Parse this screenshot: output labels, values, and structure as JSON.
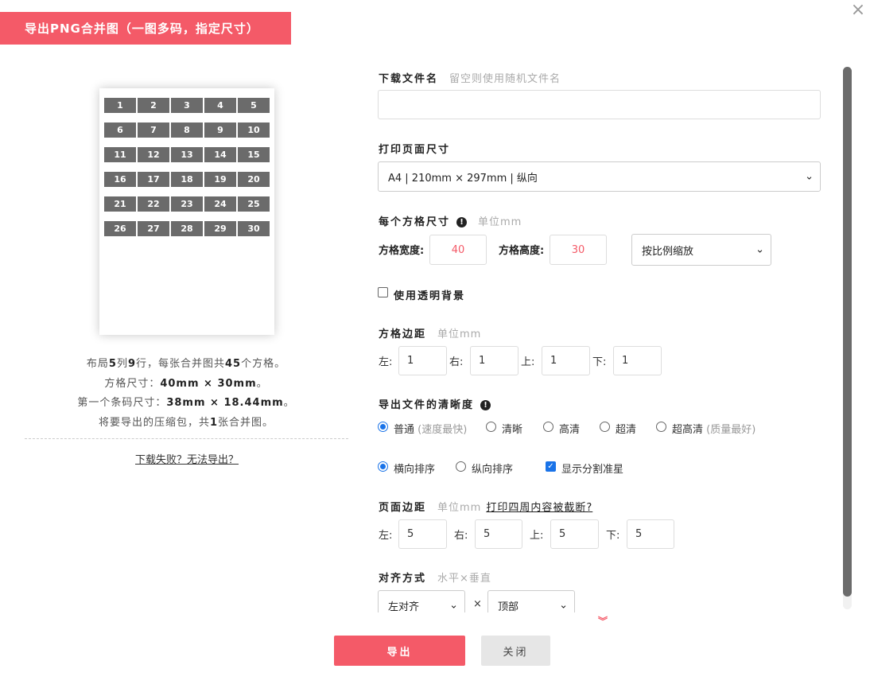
{
  "dialog": {
    "title": "导出PNG合并图（一图多码，指定尺寸）",
    "close_glyph": "×"
  },
  "preview": {
    "cells": [
      "1",
      "2",
      "3",
      "4",
      "5",
      "6",
      "7",
      "8",
      "9",
      "10",
      "11",
      "12",
      "13",
      "14",
      "15",
      "16",
      "17",
      "18",
      "19",
      "20",
      "21",
      "22",
      "23",
      "24",
      "25",
      "26",
      "27",
      "28",
      "29",
      "30"
    ],
    "summary": {
      "line1_a": "布局",
      "cols": "5",
      "line1_b": "列",
      "rows": "9",
      "line1_c": "行，每张合并图共",
      "total": "45",
      "line1_d": "个方格。",
      "line2_a": "方格尺寸：",
      "cell_size": "40mm × 30mm",
      "line2_b": "。",
      "line3_a": "第一个条码尺寸：",
      "barcode_size": "38mm × 18.44mm",
      "line3_b": "。",
      "line4_a": "将要导出的压缩包，共",
      "count": "1",
      "line4_b": "张合并图。"
    },
    "fail_link": "下载失败？无法导出？"
  },
  "form": {
    "filename": {
      "label": "下载文件名",
      "hint": "留空则使用随机文件名",
      "value": ""
    },
    "page_size": {
      "label": "打印页面尺寸",
      "selected": "A4 | 210mm × 297mm | 纵向"
    },
    "cell_size": {
      "label": "每个方格尺寸",
      "info": "!",
      "hint": "单位mm",
      "width_label": "方格宽度:",
      "width_value": "40",
      "height_label": "方格高度:",
      "height_value": "30",
      "scale_selected": "按比例缩放"
    },
    "transparent_bg": {
      "label": "使用透明背景",
      "checked": false
    },
    "cell_margin": {
      "label": "方格边距",
      "hint": "单位mm",
      "left_label": "左:",
      "left": "1",
      "right_label": "右:",
      "right": "1",
      "top_label": "上:",
      "top": "1",
      "bottom_label": "下:",
      "bottom": "1"
    },
    "resolution": {
      "label": "导出文件的清晰度",
      "info": "!",
      "options": [
        {
          "label": "普通",
          "sub": "(速度最快)",
          "checked": true
        },
        {
          "label": "清晰",
          "sub": "",
          "checked": false
        },
        {
          "label": "高清",
          "sub": "",
          "checked": false
        },
        {
          "label": "超清",
          "sub": "",
          "checked": false
        },
        {
          "label": "超高清",
          "sub": "(质量最好)",
          "checked": false
        }
      ]
    },
    "order": {
      "horizontal": "横向排序",
      "horizontal_checked": true,
      "vertical": "纵向排序",
      "vertical_checked": false,
      "crop_marks": "显示分割准星",
      "crop_marks_checked": true,
      "check_glyph": "✓"
    },
    "page_margin": {
      "label": "页面边距",
      "hint": "单位mm",
      "link": "打印四周内容被截断?",
      "left_label": "左:",
      "left": "5",
      "right_label": "右:",
      "right": "5",
      "top_label": "上:",
      "top": "5",
      "bottom_label": "下:",
      "bottom": "5"
    },
    "alignment": {
      "label": "对齐方式",
      "hint": "水平×垂直",
      "horizontal_selected": "左对齐",
      "times": "×",
      "vertical_selected": "顶部"
    }
  },
  "footer": {
    "more_icon": "»",
    "export_label": "导出",
    "close_label": "关闭"
  },
  "colors": {
    "accent": "#f45a68",
    "cell_bg": "#6b6b6b",
    "radio_blue": "#1a73e8"
  }
}
